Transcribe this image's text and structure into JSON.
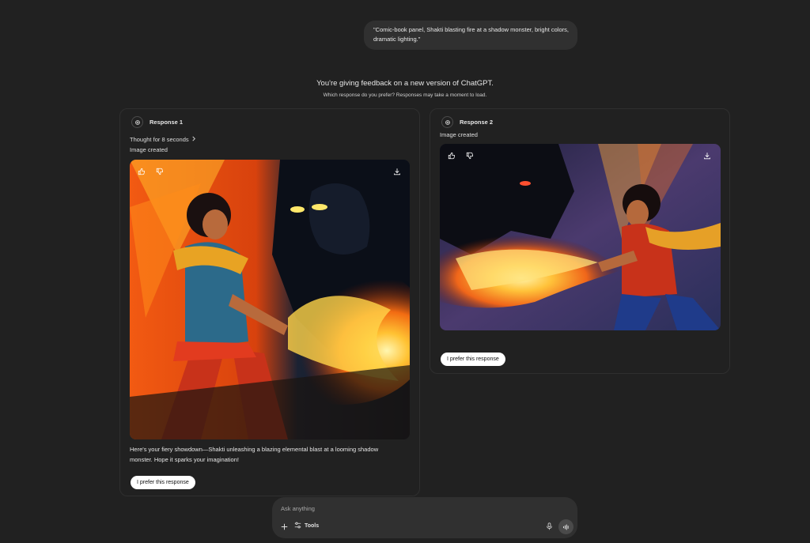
{
  "prompt": {
    "text": "\"Comic-book panel, Shakti blasting fire at a shadow monster, bright colors, dramatic lighting.\""
  },
  "feedback": {
    "title": "You're giving feedback on a new version of ChatGPT.",
    "subtitle": "Which response do you prefer? Responses may take a moment to load."
  },
  "responses": [
    {
      "label": "Response 1",
      "thought": "Thought for 8 seconds",
      "status": "Image created",
      "caption_line1": "Here's your fiery showdown—Shakti unleashing a blazing elemental blast at a looming shadow",
      "caption_line2": "monster. Hope it sparks your imagination!",
      "prefer_label": "I prefer this response"
    },
    {
      "label": "Response 2",
      "status": "Image created",
      "prefer_label": "I prefer this response"
    }
  ],
  "composer": {
    "placeholder": "Ask anything",
    "tools_label": "Tools"
  },
  "icons": {
    "logo": "openai-logo-icon",
    "thumbs_up": "thumbs-up-icon",
    "thumbs_down": "thumbs-down-icon",
    "download": "download-icon",
    "chevron": "chevron-right-icon",
    "plus": "plus-icon",
    "tools": "sliders-icon",
    "mic": "microphone-icon",
    "voice": "voice-mode-icon"
  },
  "colors": {
    "background": "#212121",
    "bubble": "#303030",
    "button": "#ffffff"
  }
}
